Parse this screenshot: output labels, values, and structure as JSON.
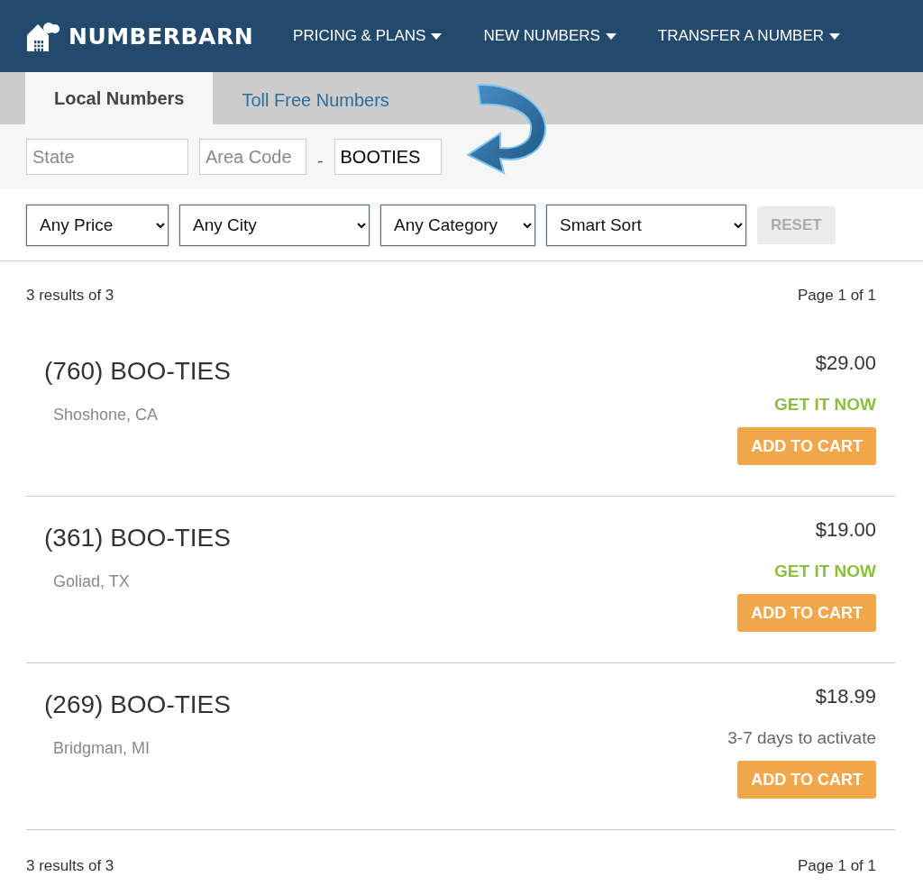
{
  "header": {
    "logo": "NUMBERBARN",
    "nav": [
      {
        "label": "PRICING & PLANS"
      },
      {
        "label": "NEW NUMBERS"
      },
      {
        "label": "TRANSFER A NUMBER"
      }
    ]
  },
  "tabs": [
    {
      "label": "Local Numbers",
      "selected": true
    },
    {
      "label": "Toll Free Numbers",
      "selected": false
    }
  ],
  "search": {
    "state": {
      "placeholder": "State"
    },
    "area_code": {
      "placeholder": "Area Code"
    },
    "separator": "-",
    "word": {
      "value": "BOOTIES"
    }
  },
  "filters": [
    {
      "value": "Any Price"
    },
    {
      "value": "Any City"
    },
    {
      "value": "Any Category"
    },
    {
      "value": "Smart Sort"
    }
  ],
  "reset": {
    "label": "RESET",
    "disabled": true
  },
  "summary_top": {
    "count": "3 results of 3",
    "page": "Page 1 of 1"
  },
  "results": [
    {
      "number": "(760) BOO-TIES",
      "location": "Shoshone, CA",
      "price": "$29.00",
      "availability": "GET IT NOW",
      "kind": "instant",
      "button": "ADD TO CART"
    },
    {
      "number": "(361) BOO-TIES",
      "location": "Goliad, TX",
      "price": "$19.00",
      "availability": "GET IT NOW",
      "kind": "instant",
      "button": "ADD TO CART"
    },
    {
      "number": "(269) BOO-TIES",
      "location": "Bridgman, MI",
      "price": "$18.99",
      "availability": "3-7 days to activate",
      "kind": "delayed",
      "button": "ADD TO CART"
    }
  ],
  "summary_bottom": {
    "count": "3 results of 3",
    "page": "Page 1 of 1"
  }
}
